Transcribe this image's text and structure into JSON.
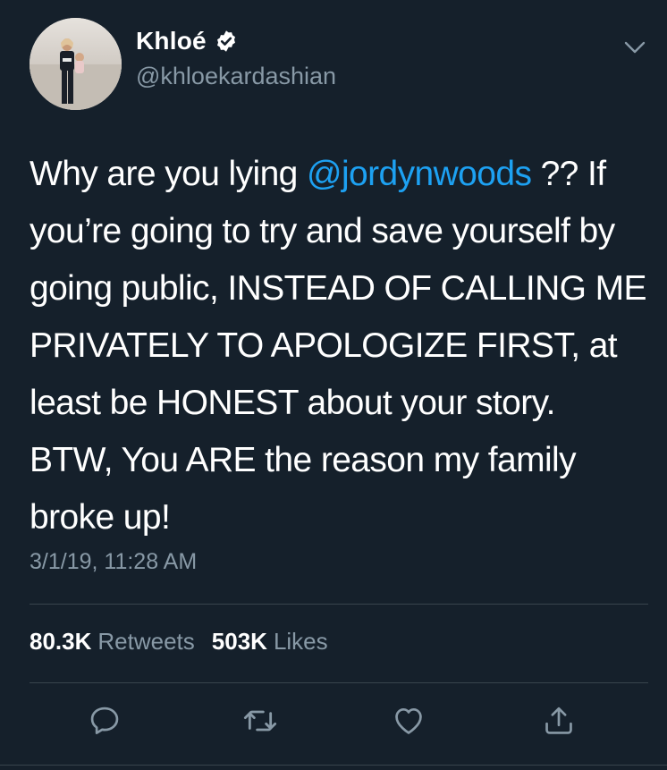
{
  "author": {
    "display_name": "Khloé",
    "handle": "@khloekardashian",
    "verified": true,
    "avatar_icon": "profile-photo"
  },
  "tweet": {
    "text_before_mention": "Why are you lying ",
    "mention": "@jordynwoods",
    "text_after_mention": " ?? If you’re going to try and save yourself by going public, INSTEAD OF CALLING ME PRIVATELY TO APOLOGIZE FIRST, at least be HONEST about your story. BTW, You ARE the reason my family broke up!",
    "timestamp": "3/1/19, 11:28 AM"
  },
  "stats": {
    "retweets_count": "80.3K",
    "retweets_label": "Retweets",
    "likes_count": "503K",
    "likes_label": "Likes"
  },
  "actions": [
    {
      "name": "reply",
      "icon": "reply-icon"
    },
    {
      "name": "retweet",
      "icon": "retweet-icon"
    },
    {
      "name": "like",
      "icon": "heart-icon"
    },
    {
      "name": "share",
      "icon": "share-icon"
    }
  ],
  "colors": {
    "background": "#15202b",
    "text": "#ffffff",
    "secondary_text": "#8899a6",
    "link": "#1da1f2",
    "divider": "#38444d"
  }
}
